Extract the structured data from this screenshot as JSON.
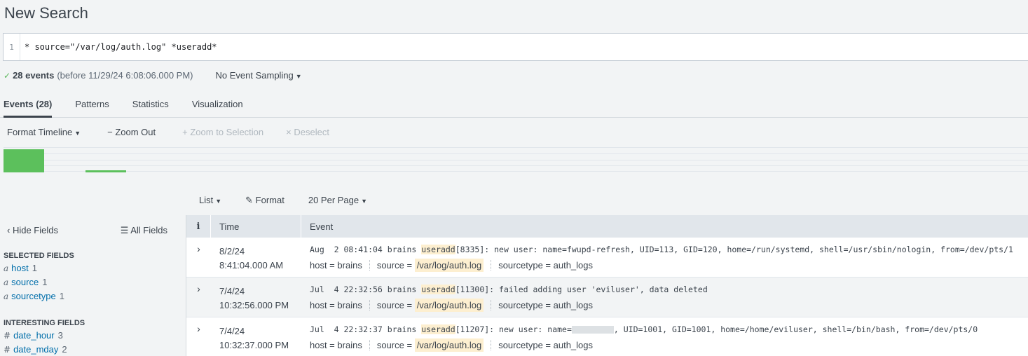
{
  "page": {
    "title": "New Search"
  },
  "search": {
    "line_number": "1",
    "query": "* source=\"/var/log/auth.log\" *useradd*"
  },
  "status": {
    "events_label": "28 events",
    "before": "(before 11/29/24 6:08:06.000 PM)",
    "sampling": "No Event Sampling"
  },
  "tabs": [
    "Events (28)",
    "Patterns",
    "Statistics",
    "Visualization"
  ],
  "timeline_toolbar": {
    "format_timeline": "Format Timeline",
    "zoom_out": "Zoom Out",
    "zoom_selection": "Zoom to Selection",
    "deselect": "Deselect"
  },
  "timeline_bars": [
    {
      "bucket": 0,
      "level": 1.0
    },
    {
      "bucket": 2,
      "level": 0.1
    }
  ],
  "list_toolbar": {
    "list": "List",
    "format": "Format",
    "per_page": "20 Per Page"
  },
  "sidebar": {
    "hide_fields": "Hide Fields",
    "all_fields": "All Fields",
    "selected_title": "SELECTED FIELDS",
    "selected": [
      {
        "type": "a",
        "name": "host",
        "count": "1"
      },
      {
        "type": "a",
        "name": "source",
        "count": "1"
      },
      {
        "type": "a",
        "name": "sourcetype",
        "count": "1"
      }
    ],
    "interesting_title": "INTERESTING FIELDS",
    "interesting": [
      {
        "type": "#",
        "name": "date_hour",
        "count": "3"
      },
      {
        "type": "#",
        "name": "date_mday",
        "count": "2"
      }
    ]
  },
  "table": {
    "headers": {
      "info": "i",
      "time": "Time",
      "event": "Event"
    },
    "rows": [
      {
        "date": "8/2/24",
        "time": "8:41:04.000 AM",
        "prefix": "Aug  2 08:41:04 brains ",
        "keyword": "useradd",
        "rest_a": "[8335]: new user: name=fwupd-refresh, UID=113, GID=120, home=/run/systemd, shell=/usr/sbin/nologin, from=/dev/pts/1",
        "rest_b": "",
        "host": "brains",
        "source": "/var/log/auth.log",
        "sourcetype": "auth_logs"
      },
      {
        "date": "7/4/24",
        "time": "10:32:56.000 PM",
        "prefix": "Jul  4 22:32:56 brains ",
        "keyword": "useradd",
        "rest_a": "[11300]: failed adding user 'eviluser', data deleted",
        "rest_b": "",
        "host": "brains",
        "source": "/var/log/auth.log",
        "sourcetype": "auth_logs"
      },
      {
        "date": "7/4/24",
        "time": "10:32:37.000 PM",
        "prefix": "Jul  4 22:32:37 brains ",
        "keyword": "useradd",
        "rest_a": "[11207]: new user: name=",
        "rest_b": ", UID=1001, GID=1001, home=/home/eviluser, shell=/bin/bash, from=/dev/pts/0",
        "host": "brains",
        "source": "/var/log/auth.log",
        "sourcetype": "auth_logs"
      }
    ],
    "meta_labels": {
      "host": "host =",
      "source": "source =",
      "sourcetype": "sourcetype ="
    }
  }
}
